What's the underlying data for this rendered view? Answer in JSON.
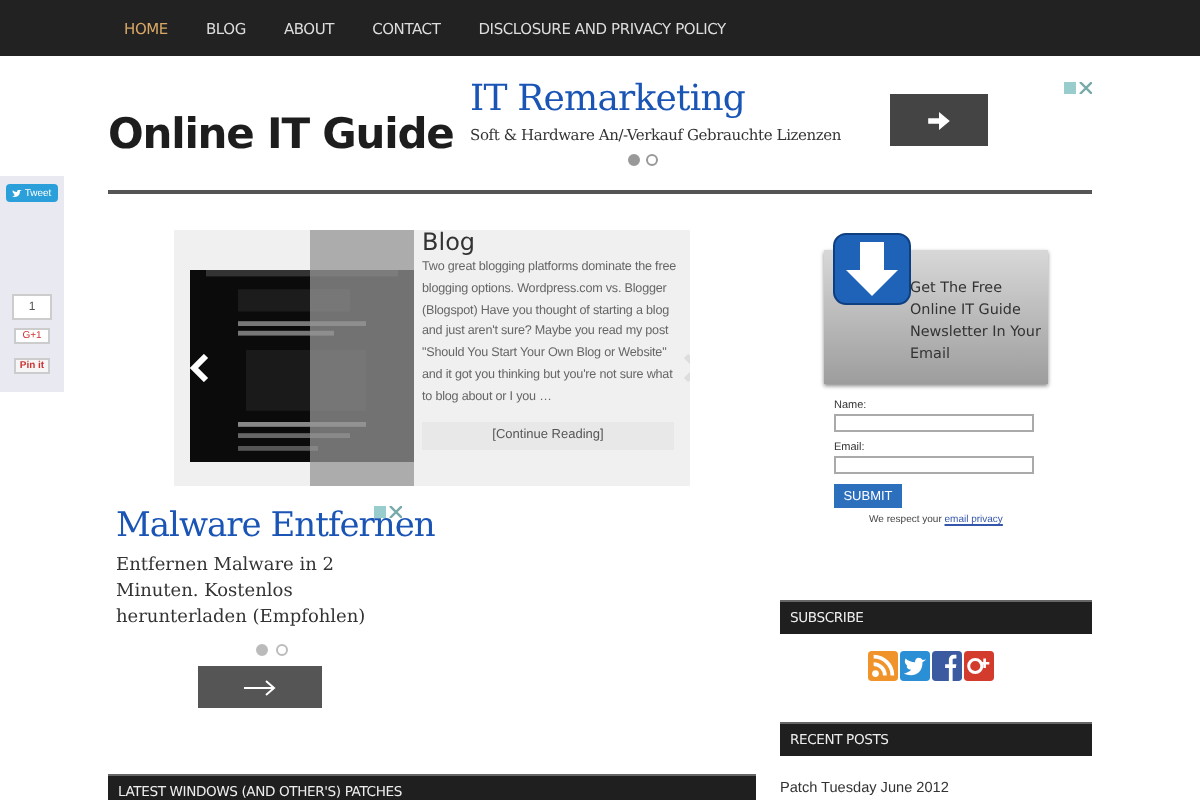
{
  "nav": {
    "items": [
      {
        "label": "HOME",
        "selected": true
      },
      {
        "label": "BLOG",
        "selected": false
      },
      {
        "label": "ABOUT",
        "selected": false
      },
      {
        "label": "CONTACT",
        "selected": false
      },
      {
        "label": "DISCLOSURE AND PRIVACY POLICY",
        "selected": false
      }
    ]
  },
  "site_title": "Online IT Guide",
  "header_ad": {
    "title": "IT Remarketing",
    "text": "Soft & Hardware An/-Verkauf Gebrauchte Lizenzen",
    "dots": [
      {
        "selected": true
      },
      {
        "selected": false
      }
    ]
  },
  "share_bar": {
    "tweet": "Tweet",
    "count": "1",
    "plus_one": "G+1",
    "pin": "Pin it"
  },
  "slider": {
    "title": "Blog",
    "excerpt": "Two great blogging platforms dominate the free blogging options. Wordpress.com vs. Blogger (Blogspot) Have you thought of starting a blog and just aren't sure? Maybe you read my post \"Should You Start Your Own Blog or Website\" and it got you thinking but you're not sure what to blog about or I you …",
    "button": "[Continue Reading]"
  },
  "content_ad": {
    "title": "Malware Entfernen",
    "text": "Entfernen Malware in 2 Minuten. Kostenlos herunterladen (Empfohlen)",
    "dots": [
      {
        "selected": true
      },
      {
        "selected": false
      }
    ]
  },
  "patches_heading": "LATEST WINDOWS (AND OTHER'S) PATCHES",
  "newsletter": {
    "heading": "Get The Free Online IT Guide Newsletter In Your Email",
    "name_label": "Name:",
    "email_label": "Email:",
    "submit": "SUBMIT",
    "note": "We respect your",
    "link": "email privacy"
  },
  "subscribe": {
    "heading": "SUBSCRIBE"
  },
  "recent_posts": {
    "heading": "RECENT POSTS",
    "posts": [
      "Patch Tuesday June 2012"
    ]
  }
}
